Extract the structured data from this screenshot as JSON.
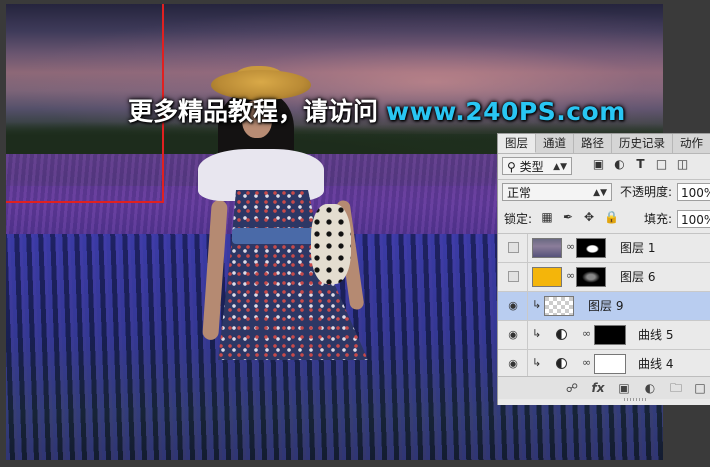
{
  "watermark": {
    "cn_text": "更多精品教程，请访问",
    "url": "www.240PS.com"
  },
  "layers_panel": {
    "tabs": [
      {
        "label": "图层",
        "active": true
      },
      {
        "label": "通道",
        "active": false
      },
      {
        "label": "路径",
        "active": false
      },
      {
        "label": "历史记录",
        "active": false
      },
      {
        "label": "动作",
        "active": false
      }
    ],
    "filter": {
      "label": "类型",
      "icon": "search-icon"
    },
    "blend_mode": "正常",
    "opacity_label": "不透明度:",
    "opacity_value": "100%",
    "lock_label": "锁定:",
    "fill_label": "填充:",
    "fill_value": "100%",
    "layers": [
      {
        "name": "图层 1",
        "visible": false,
        "type": "photo",
        "selected": false
      },
      {
        "name": "图层 6",
        "visible": false,
        "type": "fill",
        "fill_color": "#f4b50a",
        "selected": false
      },
      {
        "name": "图层 9",
        "visible": true,
        "type": "transparent",
        "clipped": true,
        "selected": true
      },
      {
        "name": "曲线 5",
        "visible": true,
        "type": "curves",
        "clipped": true,
        "mask": "black",
        "selected": false
      },
      {
        "name": "曲线 4",
        "visible": true,
        "type": "curves",
        "clipped": true,
        "mask": "white",
        "selected": false
      }
    ],
    "bottom_icons": [
      "link-icon",
      "fx-icon",
      "mask-icon",
      "adjustment-icon",
      "group-folder-icon",
      "new-layer-icon"
    ],
    "fx_label": "fx"
  },
  "colors": {
    "selection_highlight": "#b9cdf0",
    "watermark_url": "#29c6f3",
    "guide_box": "#e02020"
  }
}
